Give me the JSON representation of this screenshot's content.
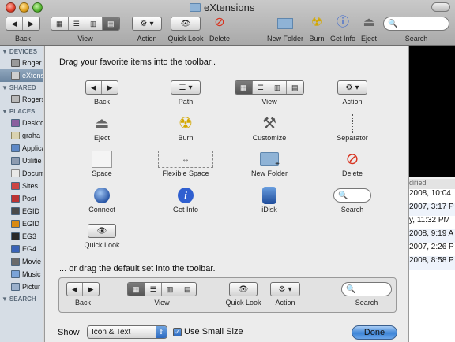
{
  "window": {
    "title": "eXtensions"
  },
  "toolbar": {
    "back": "Back",
    "view": "View",
    "action": "Action",
    "quick_look": "Quick Look",
    "delete": "Delete",
    "new_folder": "New Folder",
    "burn": "Burn",
    "get_info": "Get Info",
    "eject": "Eject",
    "search": "Search"
  },
  "sidebar": {
    "devices_heading": "DEVICES",
    "devices": [
      "Roger",
      "eXtens"
    ],
    "shared_heading": "SHARED",
    "shared": [
      "Rogers"
    ],
    "places_heading": "PLACES",
    "places": [
      "Deskto",
      "graha",
      "Applica",
      "Utilitie",
      "Docume",
      "Sites",
      "Post",
      "EGID",
      "EGID",
      "EG3",
      "EG4",
      "Movie",
      "Music",
      "Pictur"
    ],
    "search_heading": "SEARCH"
  },
  "background_list": {
    "column_header": "dified",
    "rows": [
      "2008, 10:04",
      "2007, 3:17 P",
      "y, 11:32 PM",
      "2008, 9:19 A",
      "2007, 2:26 P",
      "2008, 8:58 P"
    ]
  },
  "sheet": {
    "instruction": "Drag your favorite items into the toolbar..",
    "items": {
      "back": "Back",
      "path": "Path",
      "view": "View",
      "action": "Action",
      "eject": "Eject",
      "burn": "Burn",
      "customize": "Customize",
      "separator": "Separator",
      "space": "Space",
      "flexible_space": "Flexible Space",
      "new_folder": "New Folder",
      "delete": "Delete",
      "connect": "Connect",
      "get_info": "Get Info",
      "idisk": "iDisk",
      "search": "Search",
      "quick_look": "Quick Look"
    },
    "default_instruction": "... or drag the default set into the toolbar.",
    "default_set": {
      "back": "Back",
      "view": "View",
      "quick_look": "Quick Look",
      "action": "Action",
      "search": "Search"
    },
    "show_label": "Show",
    "show_value": "Icon & Text",
    "small_size_label": "Use Small Size",
    "small_size_checked": true,
    "done": "Done"
  },
  "colors": {
    "accent": "#3d84d6",
    "delete_red": "#d8331f",
    "info_blue": "#2f5fd0",
    "burn_yellow": "#f2c814"
  }
}
